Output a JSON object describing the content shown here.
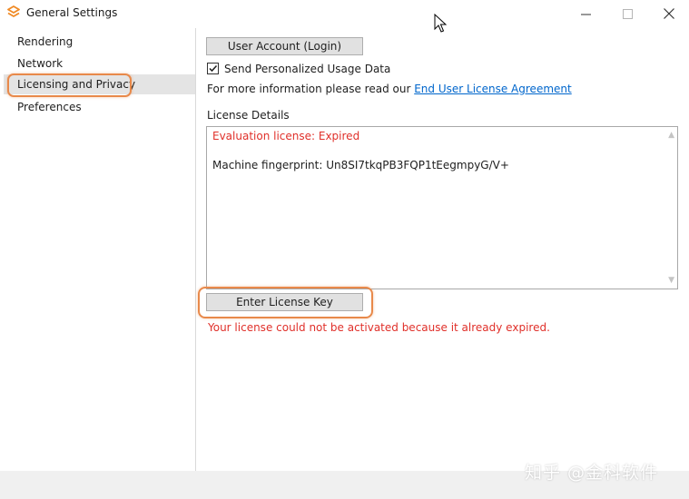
{
  "window": {
    "title": "General Settings",
    "logo_icon": "app-logo-icon",
    "controls": {
      "minimize": "—",
      "maximize": "☐",
      "close": "✕"
    }
  },
  "sidebar": {
    "items": [
      {
        "label": "Rendering",
        "selected": false
      },
      {
        "label": "Network",
        "selected": false
      },
      {
        "label": "Licensing and Privacy",
        "selected": true
      },
      {
        "label": "Preferences",
        "selected": false
      }
    ]
  },
  "main": {
    "account_button": "User Account (Login)",
    "usage_checkbox": {
      "label": "Send Personalized Usage Data",
      "checked": true
    },
    "info_prefix": "For more information please read our ",
    "eula_link": "End User License Agreement",
    "details_label": "License Details",
    "details": {
      "status": "Evaluation license: Expired",
      "fingerprint": "Machine fingerprint: Un8SI7tkqPB3FQP1tEegmpyG/V+"
    },
    "license_button": "Enter License Key",
    "error_message": "Your license could not be activated because it already expired."
  },
  "watermark": "知乎 @金科软件",
  "colors": {
    "accent_highlight": "#e8894a",
    "error": "#e0302a",
    "link": "#0066cc",
    "logo": "#f08a24"
  }
}
